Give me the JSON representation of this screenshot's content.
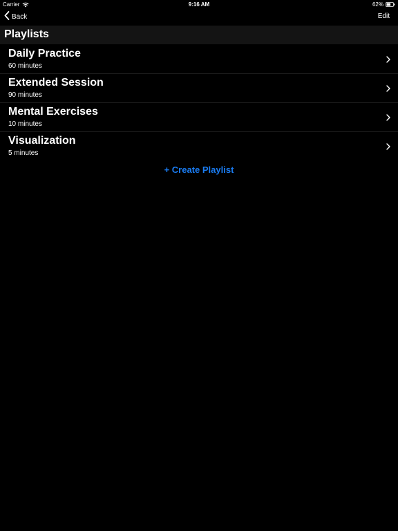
{
  "status_bar": {
    "carrier": "Carrier",
    "time": "9:16 AM",
    "battery": "62%",
    "battery_level": 0.62,
    "icons": [
      "wifi-icon",
      "battery-icon"
    ]
  },
  "nav": {
    "back_label": "Back",
    "edit_label": "Edit",
    "icons": [
      "chevron-left-icon"
    ]
  },
  "section": {
    "title": "Playlists"
  },
  "playlists": [
    {
      "name": "Daily Practice",
      "duration": "60 minutes"
    },
    {
      "name": "Extended Session",
      "duration": "90 minutes"
    },
    {
      "name": "Mental Exercises",
      "duration": "10 minutes"
    },
    {
      "name": "Visualization",
      "duration": "5 minutes"
    }
  ],
  "actions": {
    "create_label": "+ Create Playlist"
  },
  "colors": {
    "background": "#000000",
    "text": "#ffffff",
    "accent": "#1a7cf2",
    "header_bg": "#141414"
  }
}
